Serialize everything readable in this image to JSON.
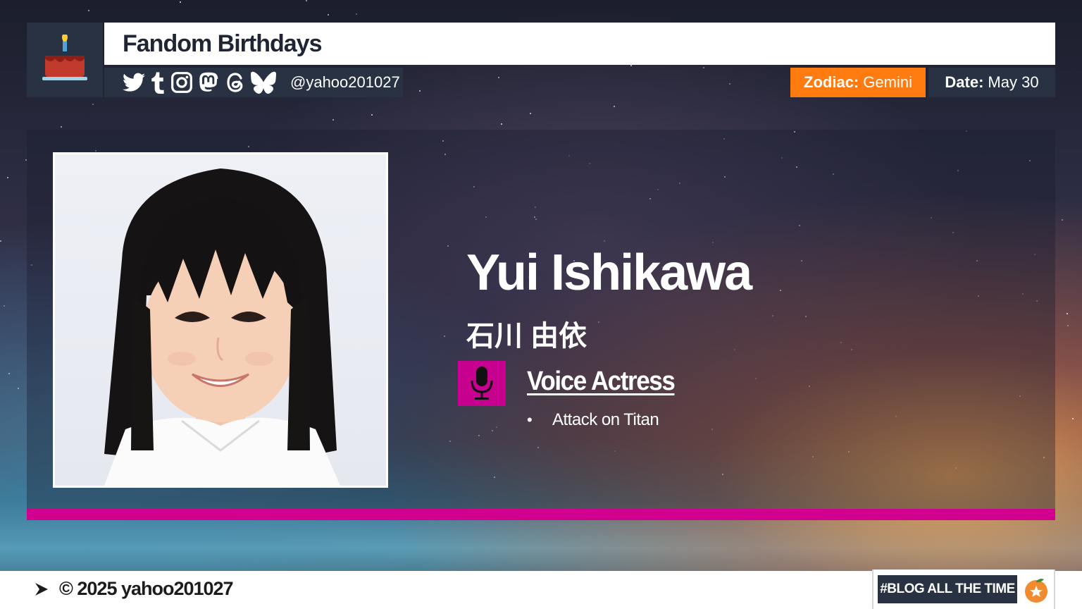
{
  "header": {
    "title": "Fandom Birthdays",
    "handle": "@yahoo201027",
    "zodiac_label": "Zodiac:",
    "zodiac_value": "Gemini",
    "date_label": "Date:",
    "date_value": "May 30",
    "social_icons": [
      "twitter-icon",
      "tumblr-icon",
      "instagram-icon",
      "mastodon-icon",
      "threads-icon",
      "bluesky-icon"
    ]
  },
  "profile": {
    "name": "Yui Ishikawa",
    "native_name": "石川 由依",
    "role": "Voice Actress",
    "role_icon": "microphone-icon",
    "works": [
      "Attack on Titan"
    ]
  },
  "footer": {
    "copyright": "© 2025 yahoo201027",
    "tag": "#BLOG ALL THE TIME"
  },
  "colors": {
    "accent": "#d1008f",
    "zodiac": "#ff7a0f",
    "navy": "#283243"
  }
}
